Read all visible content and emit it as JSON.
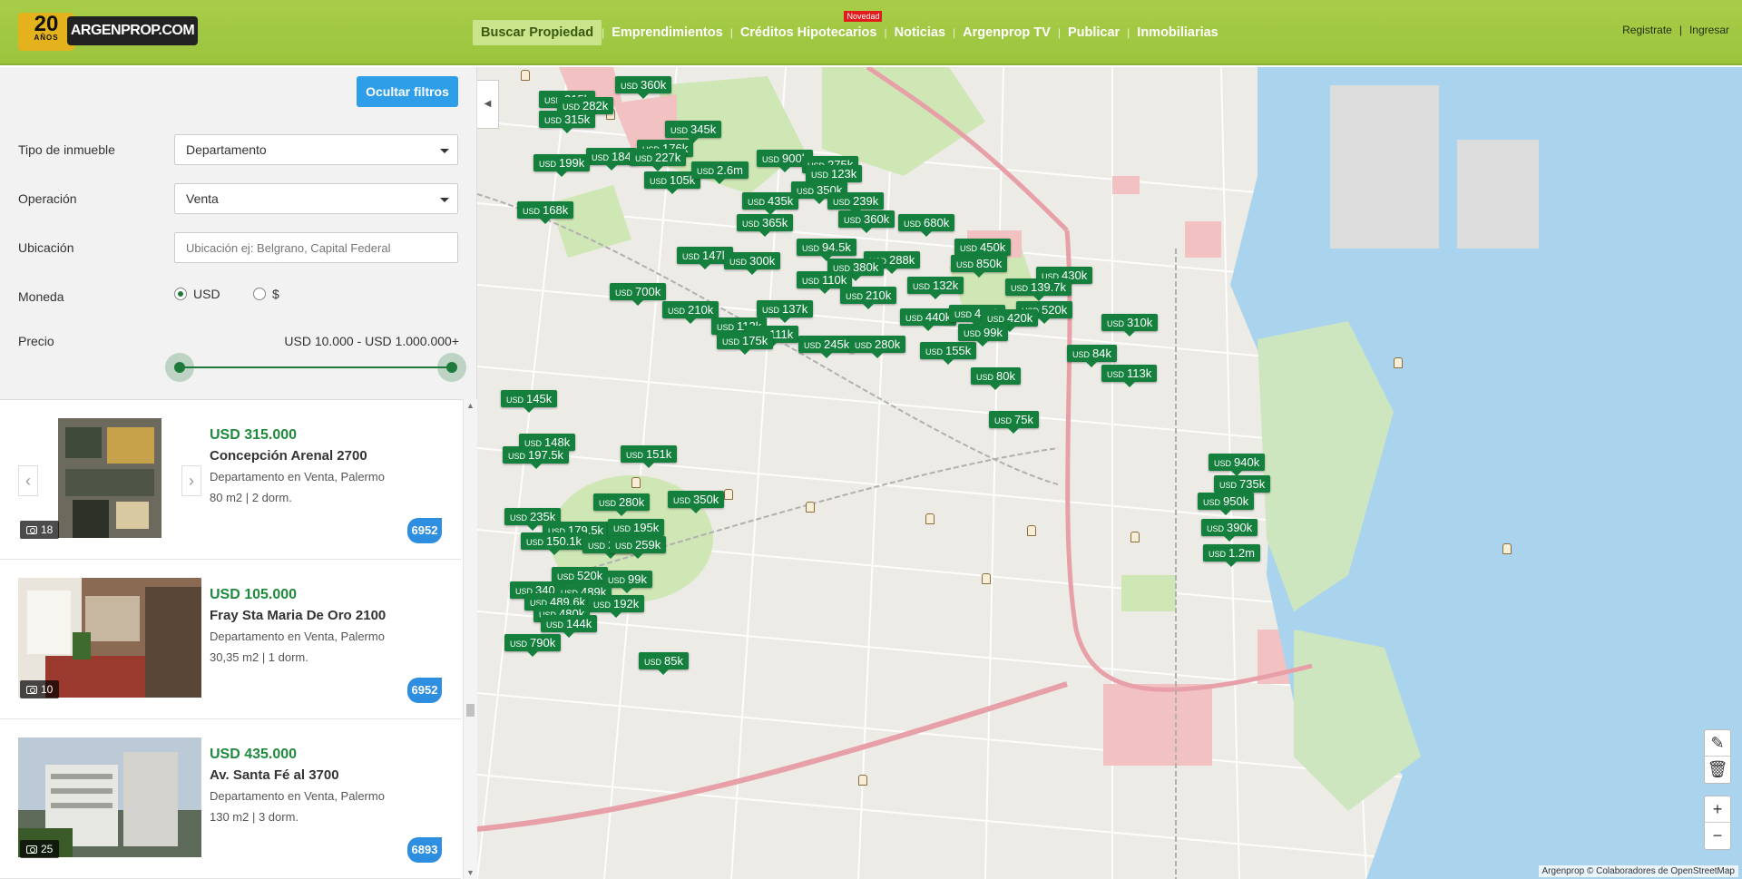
{
  "header": {
    "logo_years": "20",
    "logo_years_label": "AÑOS",
    "logo_brand": "ARGENPROP.COM",
    "nav": [
      {
        "label": "Buscar Propiedad",
        "badge": ""
      },
      {
        "label": "Emprendimientos",
        "badge": ""
      },
      {
        "label": "Créditos Hipotecarios",
        "badge": "Novedad"
      },
      {
        "label": "Noticias",
        "badge": ""
      },
      {
        "label": "Argenprop TV",
        "badge": ""
      },
      {
        "label": "Publicar",
        "badge": ""
      },
      {
        "label": "Inmobiliarias",
        "badge": ""
      }
    ],
    "register": "Registrate",
    "auth_sep": "|",
    "login": "Ingresar"
  },
  "filters": {
    "hide_button": "Ocultar filtros",
    "tipo_label": "Tipo de inmueble",
    "tipo_value": "Departamento",
    "operacion_label": "Operación",
    "operacion_value": "Venta",
    "ubicacion_label": "Ubicación",
    "ubicacion_placeholder": "Ubicación ej: Belgrano, Capital Federal",
    "moneda_label": "Moneda",
    "moneda_options": [
      "USD",
      "$"
    ],
    "moneda_selected": "USD",
    "precio_label": "Precio",
    "precio_range": "USD 10.000 - USD 1.000.000+",
    "precio_min_fraction": 0,
    "precio_max_fraction": 1
  },
  "listings": [
    {
      "price": "USD 315.000",
      "address": "Concepción Arenal 2700",
      "desc": "Departamento en Venta, Palermo",
      "specs": "80 m2 | 2 dorm.",
      "photos": "18",
      "agency": "6952"
    },
    {
      "price": "USD 105.000",
      "address": "Fray Sta Maria De Oro 2100",
      "desc": "Departamento en Venta, Palermo",
      "specs": "30,35 m2 | 1 dorm.",
      "photos": "10",
      "agency": "6952"
    },
    {
      "price": "USD 435.000",
      "address": "Av. Santa Fé al 3700",
      "desc": "Departamento en Venta, Palermo",
      "specs": "130 m2 | 3 dorm.",
      "photos": "25",
      "agency": "6893"
    }
  ],
  "map": {
    "currency": "USD",
    "pins": [
      "360k",
      "315k",
      "282k",
      "315k",
      "345k",
      "176k",
      "184",
      "227k",
      "199k",
      "105k",
      "2.6m",
      "900k",
      "275k",
      "123k",
      "350k",
      "435k",
      "239k",
      "360k",
      "168k",
      "365k",
      "680k",
      "94.5k",
      "147k",
      "300k",
      "288k",
      "380k",
      "450k",
      "850k",
      "430k",
      "700k",
      "110k",
      "132k",
      "139.7k",
      "520k",
      "210k",
      "137k",
      "210k",
      "440k",
      "488k",
      "420k",
      "99k",
      "112k",
      "111k",
      "175k",
      "245k",
      "280k",
      "155k",
      "310k",
      "84k",
      "113k",
      "80k",
      "145k",
      "75k",
      "148k",
      "197.5k",
      "151k",
      "940k",
      "735k",
      "950k",
      "280k",
      "350k",
      "235k",
      "179.5k",
      "195k",
      "390k",
      "150.1k",
      "240k",
      "259k",
      "1.2m",
      "520k",
      "99k",
      "340k",
      "489k",
      "489.6k",
      "192k",
      "480k",
      "144k",
      "790k",
      "85k"
    ],
    "attribution": "Argenprop © Colaboradores de OpenStreetMap",
    "zoom_in": "+",
    "zoom_out": "−"
  }
}
